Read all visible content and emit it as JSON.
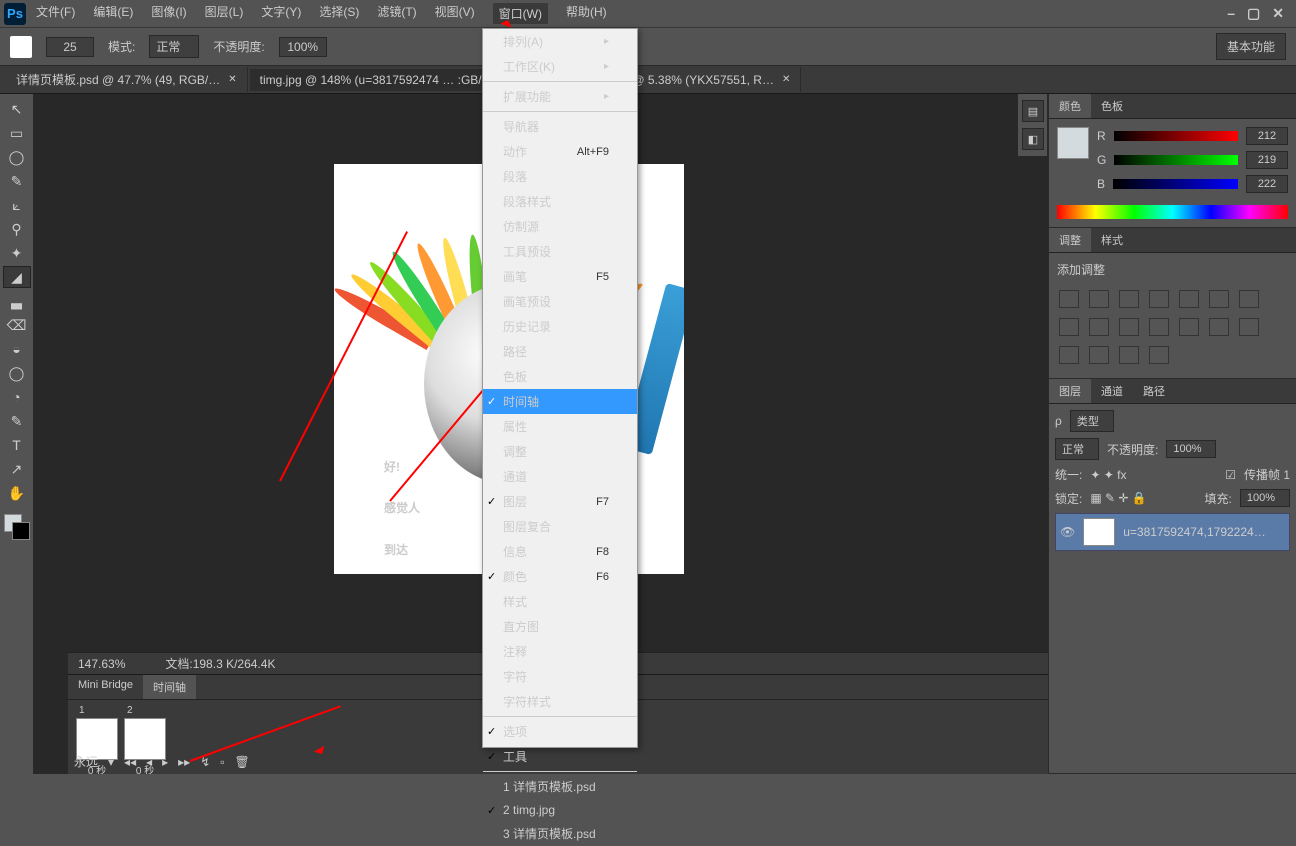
{
  "app": {
    "logo": "Ps"
  },
  "menus": [
    "文件(F)",
    "编辑(E)",
    "图像(I)",
    "图层(L)",
    "文字(Y)",
    "选择(S)",
    "滤镜(T)",
    "视图(V)",
    "窗口(W)",
    "帮助(H)"
  ],
  "menu_active_index": 8,
  "window_controls": {
    "min": "–",
    "max": "▢",
    "close": "✕"
  },
  "options": {
    "brush_size": "25",
    "mode_label": "模式:",
    "mode_value": "正常",
    "opacity_label": "不透明度:",
    "opacity_value": "100%",
    "workspace": "基本功能"
  },
  "tabs": [
    {
      "label": "详情页模板.psd @ 47.7% (49, RGB/…",
      "active": false
    },
    {
      "label": "timg.jpg @ 148% (u=3817592474 … :GB/8#) *",
      "active": true
    },
    {
      "label": "详情页模板.psd @ 5.38% (YKX57551, R…",
      "active": false
    }
  ],
  "tools": [
    "↖",
    "▭",
    "◯",
    "✎",
    "⟀",
    "⚲",
    "✦",
    "◢",
    "▃",
    "⌫",
    "◒",
    "◯",
    "◔",
    "✎",
    "T",
    "↗",
    "✋"
  ],
  "tool_active_index": 7,
  "status": {
    "zoom": "147.63%",
    "doc": "文档:198.3 K/264.4K"
  },
  "color_panel": {
    "tabs": [
      "颜色",
      "色板"
    ],
    "r": "212",
    "g": "219",
    "b": "222",
    "swatch": "#d4dbde",
    "r_label": "R",
    "g_label": "G",
    "b_label": "B"
  },
  "adjust_panel": {
    "tabs": [
      "调整",
      "样式"
    ],
    "title": "添加调整"
  },
  "layers_panel": {
    "tabs": [
      "图层",
      "通道",
      "路径"
    ],
    "kind": "类型",
    "blend": "正常",
    "opacity_label": "不透明度:",
    "opacity": "100%",
    "lock_label": "锁定:",
    "fill_label": "填充:",
    "fill": "100%",
    "unify_label": "统一:",
    "propagate_label": "传播帧 1",
    "layer_name": "u=3817592474,1792224…"
  },
  "bottom": {
    "tabs": [
      "Mini Bridge",
      "时间轴"
    ],
    "active_tab": 1,
    "frame_times": [
      "0 秒",
      "0 秒"
    ],
    "loop": "永远"
  },
  "dropdown": {
    "items": [
      {
        "label": "排列(A)",
        "submenu": true
      },
      {
        "label": "工作区(K)",
        "submenu": true
      },
      {
        "sep": true
      },
      {
        "label": "扩展功能",
        "submenu": true
      },
      {
        "sep": true
      },
      {
        "label": "导航器"
      },
      {
        "label": "动作",
        "shortcut": "Alt+F9"
      },
      {
        "label": "段落"
      },
      {
        "label": "段落样式"
      },
      {
        "label": "仿制源"
      },
      {
        "label": "工具预设"
      },
      {
        "label": "画笔",
        "shortcut": "F5"
      },
      {
        "label": "画笔预设"
      },
      {
        "label": "历史记录"
      },
      {
        "label": "路径"
      },
      {
        "label": "色板"
      },
      {
        "label": "时间轴",
        "checked": true,
        "highlight": true
      },
      {
        "label": "属性"
      },
      {
        "label": "调整"
      },
      {
        "label": "通道"
      },
      {
        "label": "图层",
        "shortcut": "F7",
        "checked": true
      },
      {
        "label": "图层复合"
      },
      {
        "label": "信息",
        "shortcut": "F8"
      },
      {
        "label": "颜色",
        "shortcut": "F6",
        "checked": true
      },
      {
        "label": "样式"
      },
      {
        "label": "直方图"
      },
      {
        "label": "注释"
      },
      {
        "label": "字符"
      },
      {
        "label": "字符样式"
      },
      {
        "sep": true
      },
      {
        "label": "选项",
        "checked": true
      },
      {
        "label": "工具",
        "checked": true
      },
      {
        "sep": true
      },
      {
        "label": "1 详情页模板.psd"
      },
      {
        "label": "2 timg.jpg",
        "checked": true
      },
      {
        "label": "3 详情页模板.psd"
      }
    ]
  },
  "canvas_text": {
    "line1": "好!",
    "line2": "感觉人",
    "line3": "到达"
  }
}
